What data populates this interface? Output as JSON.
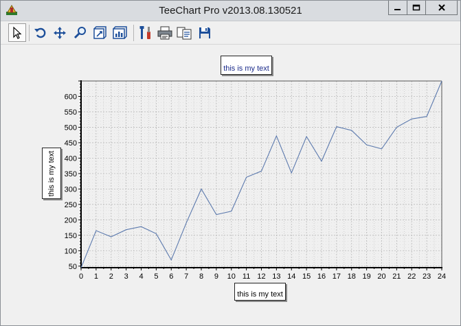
{
  "window": {
    "title": "TeeChart Pro v2013.08.130521"
  },
  "toolbar": {
    "items": [
      {
        "name": "select-arrow-icon",
        "pressed": true
      },
      {
        "name": "rotate-icon"
      },
      {
        "name": "move-icon"
      },
      {
        "name": "zoom-icon"
      },
      {
        "name": "depth-icon"
      },
      {
        "name": "view-3d-icon"
      },
      {
        "name": "edit-tools-icon"
      },
      {
        "name": "print-icon"
      },
      {
        "name": "copy-icon"
      },
      {
        "name": "save-icon"
      }
    ]
  },
  "chart": {
    "title_text": "this is my text",
    "left_axis_text": "this is my text",
    "bottom_axis_text": "this is my text"
  },
  "colors": {
    "series_line": "#5b79ad",
    "grid": "#b8b8b8",
    "axis": "#000000"
  },
  "chart_data": {
    "type": "line",
    "title": "this is my text",
    "xlabel": "this is my text",
    "ylabel": "this is my text",
    "x": [
      0,
      1,
      2,
      3,
      4,
      5,
      6,
      7,
      8,
      9,
      10,
      11,
      12,
      13,
      14,
      15,
      16,
      17,
      18,
      19,
      20,
      21,
      22,
      23,
      24
    ],
    "series": [
      {
        "values": [
          45,
          165,
          145,
          168,
          178,
          155,
          70,
          190,
          300,
          217,
          228,
          338,
          358,
          472,
          352,
          470,
          390,
          502,
          490,
          443,
          430,
          500,
          527,
          535,
          650
        ]
      }
    ],
    "xlim": [
      0,
      24
    ],
    "ylim": [
      45,
      650
    ],
    "x_ticks": [
      0,
      1,
      2,
      3,
      4,
      5,
      6,
      7,
      8,
      9,
      10,
      11,
      12,
      13,
      14,
      15,
      16,
      17,
      18,
      19,
      20,
      21,
      22,
      23,
      24
    ],
    "y_ticks": [
      50,
      100,
      150,
      200,
      250,
      300,
      350,
      400,
      450,
      500,
      550,
      600
    ],
    "grid": true,
    "legend": "none"
  }
}
